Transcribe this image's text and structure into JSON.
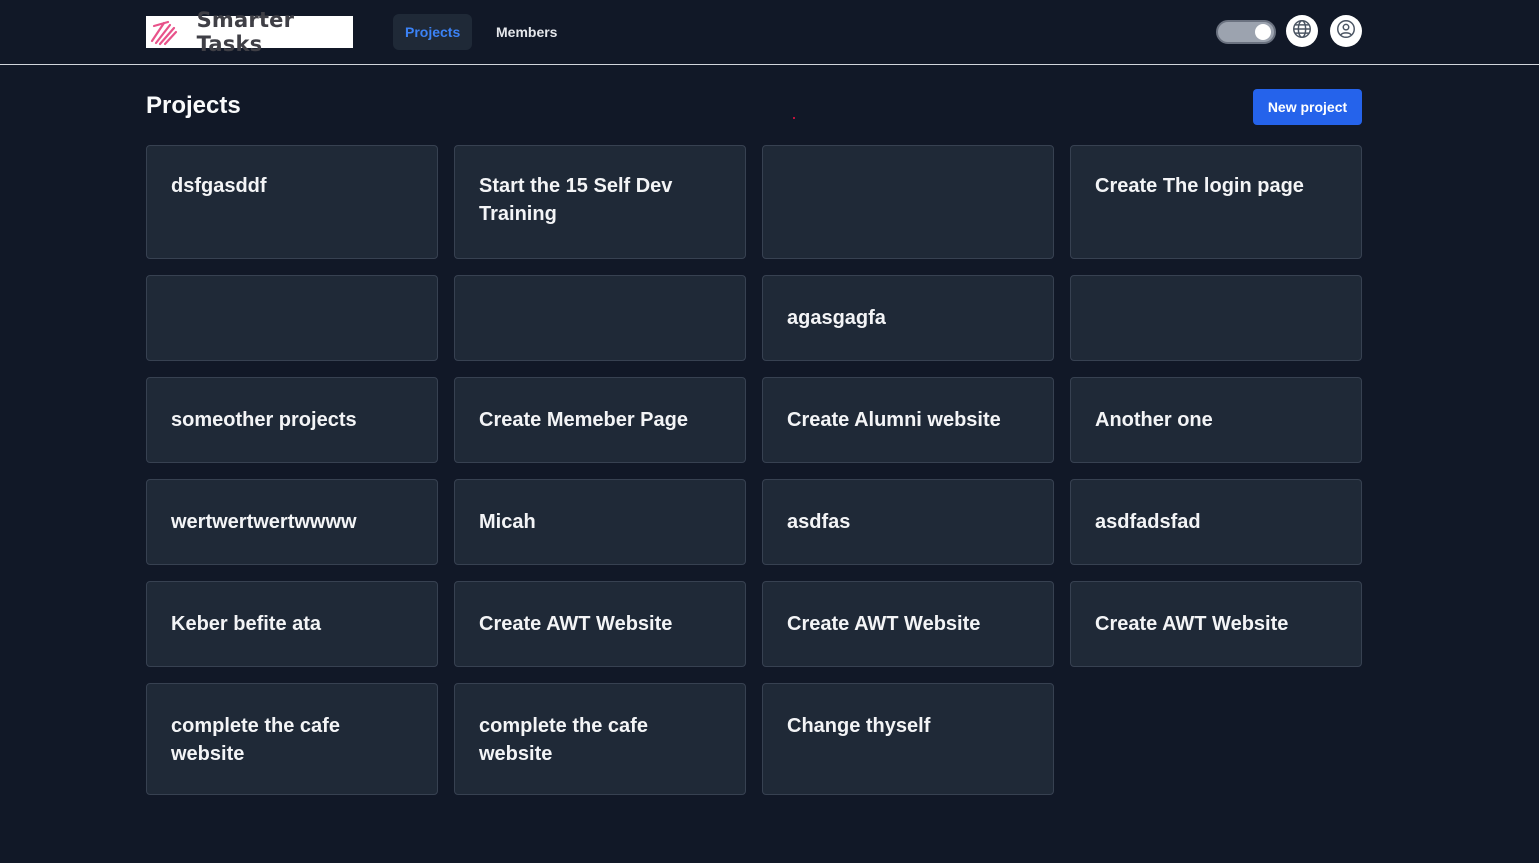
{
  "brand": {
    "name": "Smarter Tasks"
  },
  "nav": {
    "projects": "Projects",
    "members": "Members"
  },
  "page": {
    "title": "Projects",
    "new_button": "New project"
  },
  "projects": [
    "dsfgasddf",
    "Start the 15 Self Dev Training",
    "",
    "Create The login page",
    "",
    "",
    "agasgagfa",
    "",
    "someother projects",
    "Create Memeber Page",
    "Create Alumni website",
    "Another one",
    "wertwertwertwwww",
    "Micah",
    "asdfas",
    "asdfadsfad",
    "Keber befite ata",
    "Create AWT Website",
    "Create AWT Website",
    "Create AWT Website",
    "complete the cafe website",
    "complete the cafe website",
    "Change thyself"
  ],
  "colors": {
    "background": "#111827",
    "card": "#1f2937",
    "accent": "#2563eb",
    "active_nav_text": "#3b82f6"
  },
  "icons": {
    "theme_toggle": "theme-toggle",
    "language": "globe-icon",
    "user": "user-circle-icon"
  }
}
